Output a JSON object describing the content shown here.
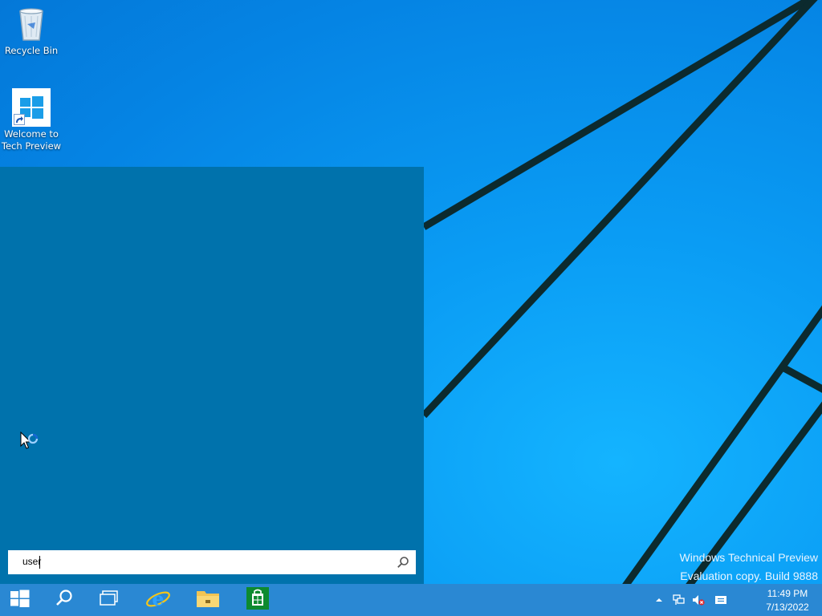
{
  "desktop": {
    "icons": [
      {
        "label": "Recycle Bin"
      },
      {
        "label_line1": "Welcome to",
        "label_line2": "Tech Preview"
      }
    ]
  },
  "search": {
    "value": "user"
  },
  "watermark": {
    "line1": "Windows Technical Preview",
    "line2": "Evaluation copy. Build 9888"
  },
  "taskbar": {
    "buttons": [
      "start-icon",
      "search-icon",
      "task-view-icon",
      "internet-explorer-icon",
      "file-explorer-icon",
      "store-icon"
    ],
    "tray": [
      "show-hidden-icons-icon",
      "network-icon",
      "volume-muted-icon",
      "action-center-icon"
    ],
    "time": "11:49 PM",
    "date": "7/13/2022"
  },
  "colors": {
    "desktop_blue": "#0a9cf4",
    "start_panel": "#0072ac",
    "taskbar": "#2a88d3"
  }
}
